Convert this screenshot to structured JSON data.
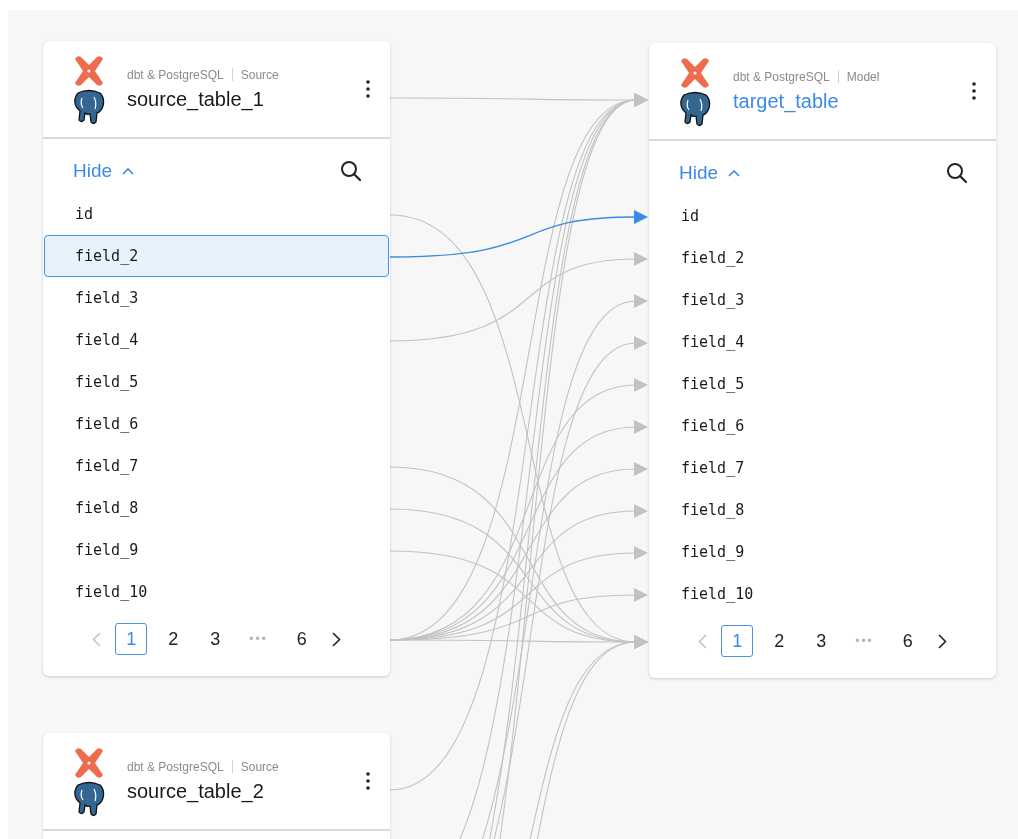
{
  "nodes": [
    {
      "platform": "dbt & PostgreSQL",
      "role": "Source",
      "title": "source_table_1",
      "highlighted": false,
      "toggle": {
        "label": "Hide",
        "expanded": true
      },
      "fields": [
        {
          "name": "id",
          "selected": false
        },
        {
          "name": "field_2",
          "selected": true
        },
        {
          "name": "field_3",
          "selected": false
        },
        {
          "name": "field_4",
          "selected": false
        },
        {
          "name": "field_5",
          "selected": false
        },
        {
          "name": "field_6",
          "selected": false
        },
        {
          "name": "field_7",
          "selected": false
        },
        {
          "name": "field_8",
          "selected": false
        },
        {
          "name": "field_9",
          "selected": false
        },
        {
          "name": "field_10",
          "selected": false
        }
      ],
      "pagination": [
        {
          "kind": "prev",
          "disabled": true
        },
        {
          "kind": "page",
          "label": "1",
          "selected": true
        },
        {
          "kind": "page",
          "label": "2",
          "selected": false
        },
        {
          "kind": "page",
          "label": "3",
          "selected": false
        },
        {
          "kind": "ellipsis",
          "label": "•••"
        },
        {
          "kind": "page",
          "label": "6",
          "selected": false
        },
        {
          "kind": "next",
          "disabled": false
        }
      ]
    },
    {
      "platform": "dbt & PostgreSQL",
      "role": "Model",
      "title": "target_table",
      "highlighted": true,
      "toggle": {
        "label": "Hide",
        "expanded": true
      },
      "fields": [
        {
          "name": "id",
          "selected": false
        },
        {
          "name": "field_2",
          "selected": false
        },
        {
          "name": "field_3",
          "selected": false
        },
        {
          "name": "field_4",
          "selected": false
        },
        {
          "name": "field_5",
          "selected": false
        },
        {
          "name": "field_6",
          "selected": false
        },
        {
          "name": "field_7",
          "selected": false
        },
        {
          "name": "field_8",
          "selected": false
        },
        {
          "name": "field_9",
          "selected": false
        },
        {
          "name": "field_10",
          "selected": false
        }
      ],
      "pagination": [
        {
          "kind": "prev",
          "disabled": true
        },
        {
          "kind": "page",
          "label": "1",
          "selected": true
        },
        {
          "kind": "page",
          "label": "2",
          "selected": false
        },
        {
          "kind": "page",
          "label": "3",
          "selected": false
        },
        {
          "kind": "ellipsis",
          "label": "•••"
        },
        {
          "kind": "page",
          "label": "6",
          "selected": false
        },
        {
          "kind": "next",
          "disabled": false
        }
      ]
    },
    {
      "platform": "dbt & PostgreSQL",
      "role": "Source",
      "title": "source_table_2",
      "highlighted": false
    }
  ]
}
